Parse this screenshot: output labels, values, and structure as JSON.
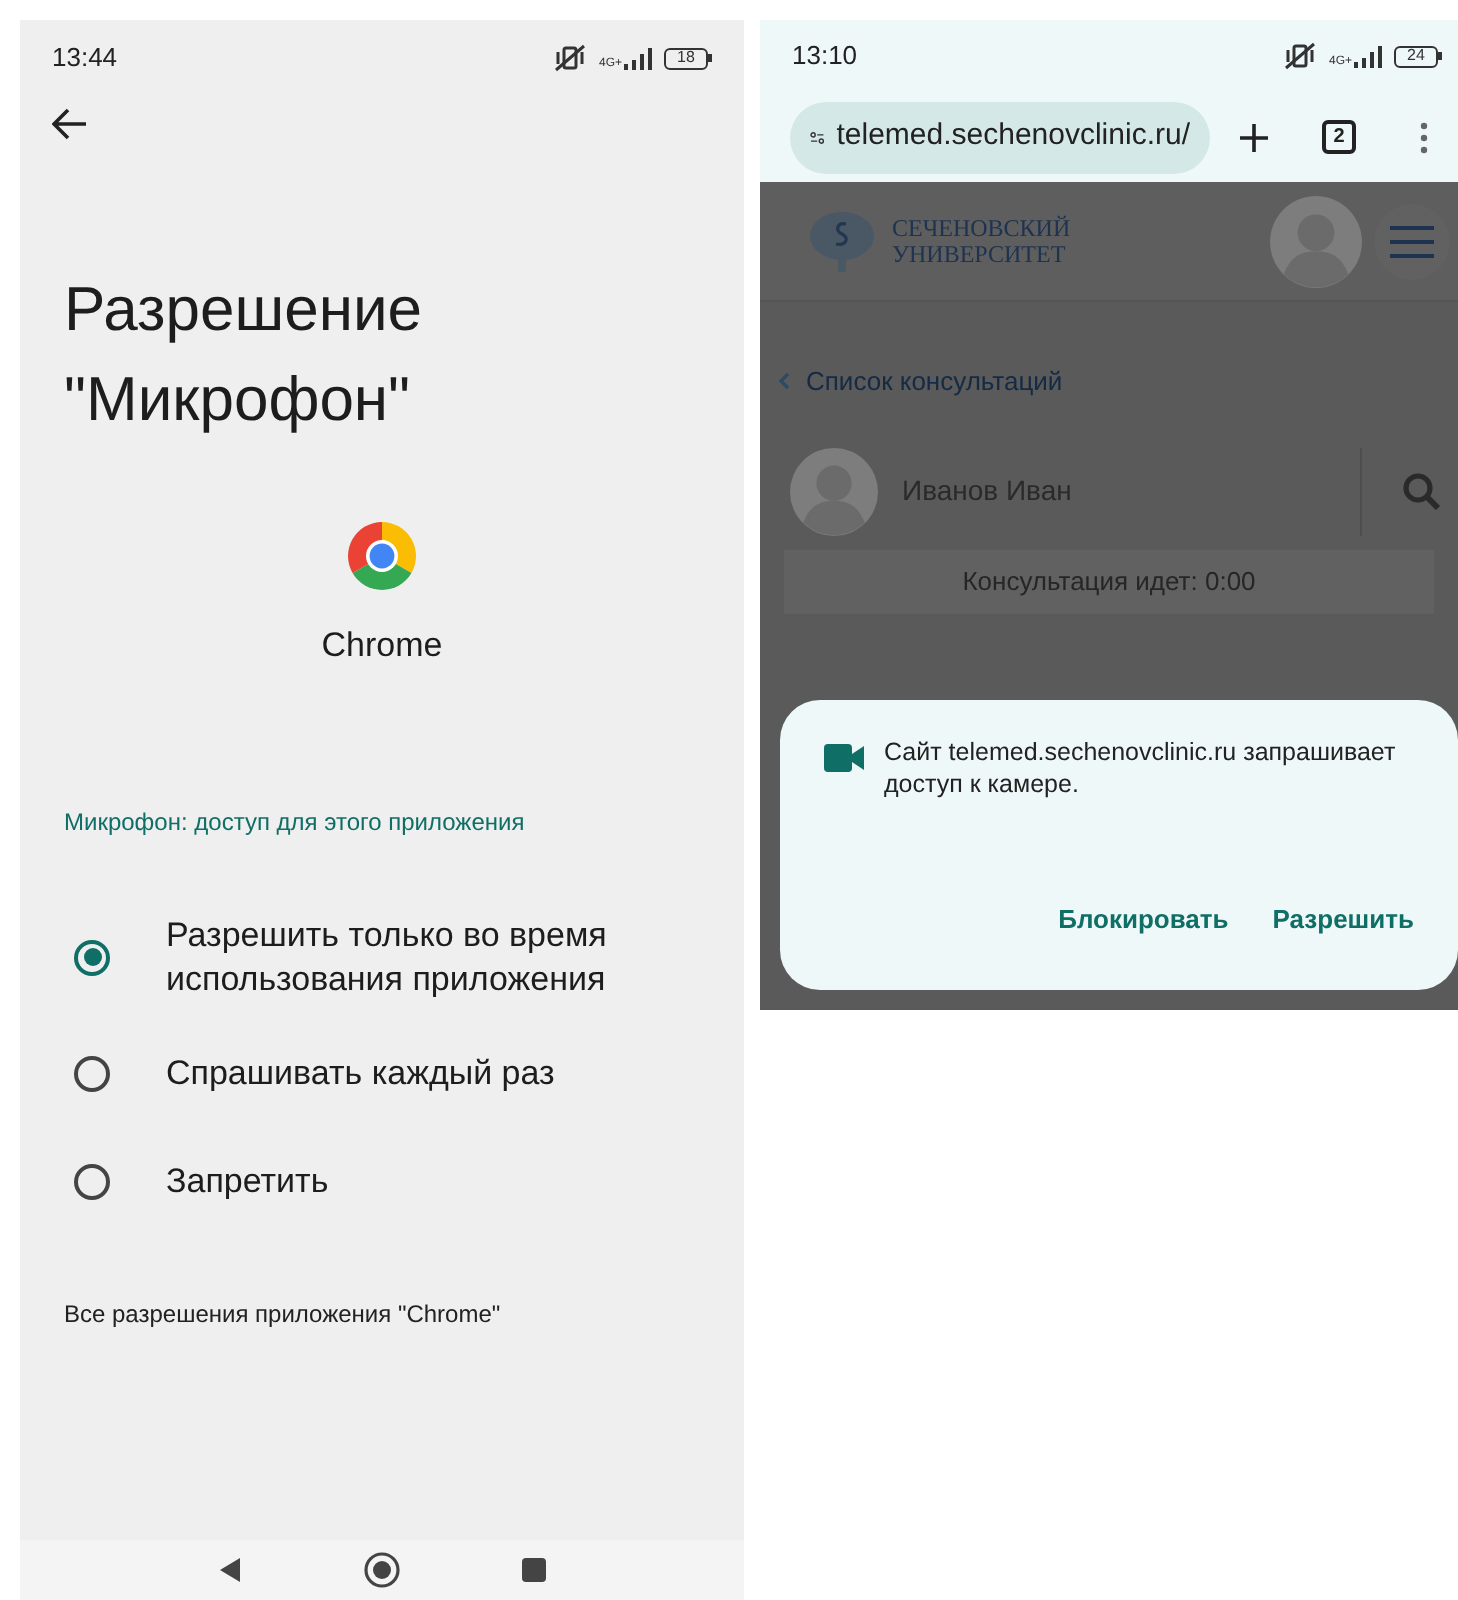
{
  "left_screen": {
    "status_bar": {
      "time": "13:44",
      "network": "4G+",
      "battery": "18"
    },
    "title": "Разрешение \"Микрофон\"",
    "app_name": "Chrome",
    "section_label": "Микрофон: доступ для этого приложения",
    "options": [
      {
        "label": "Разрешить только во время использования приложения",
        "selected": true
      },
      {
        "label": "Спрашивать каждый раз",
        "selected": false
      },
      {
        "label": "Запретить",
        "selected": false
      }
    ],
    "footer_link": "Все разрешения приложения \"Chrome\""
  },
  "right_screen": {
    "status_bar": {
      "time": "13:10",
      "network": "4G+",
      "battery": "24"
    },
    "address_bar": {
      "url": "telemed.sechenovclinic.ru/",
      "tab_count": "2"
    },
    "logo_lines": [
      "СЕЧЕНОВСКИЙ",
      "УНИВЕРСИТЕТ"
    ],
    "back_link": "Список консультаций",
    "patient_name": "Иванов Иван",
    "consultation_status": "Консультация идет: 0:00",
    "dialog": {
      "message": "Сайт telemed.sechenovclinic.ru запрашивает доступ к камере.",
      "buttons": [
        "Блокировать",
        "Разрешить"
      ]
    }
  }
}
